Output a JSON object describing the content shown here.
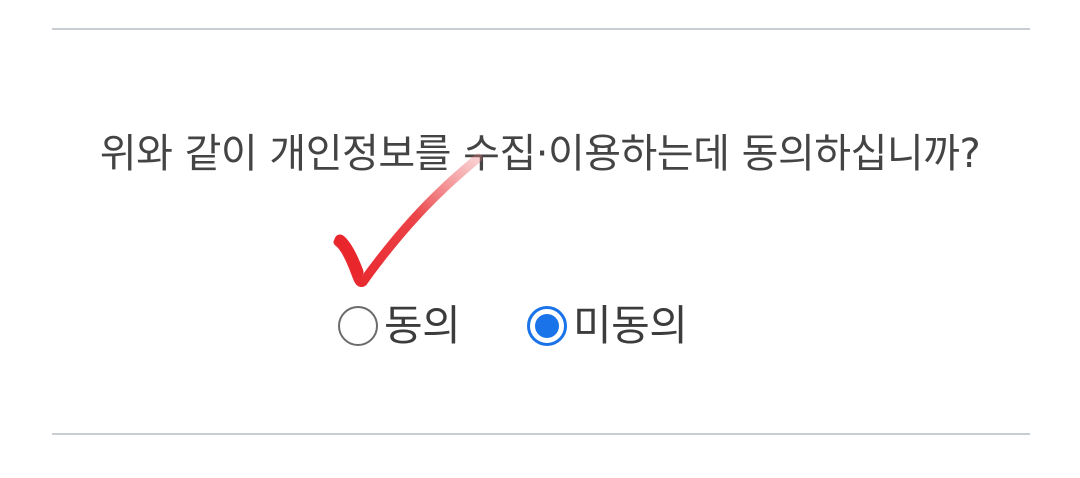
{
  "question": {
    "text": "위와 같이 개인정보를 수집·이용하는데 동의하십니까?"
  },
  "options": [
    {
      "label": "동의",
      "selected": false
    },
    {
      "label": "미동의",
      "selected": true
    }
  ],
  "colors": {
    "divider": "#c8cdd3",
    "radio_selected": "#1a73e8",
    "checkmark": "#e8262c"
  },
  "icons": {
    "annotation": "red-checkmark-icon"
  }
}
